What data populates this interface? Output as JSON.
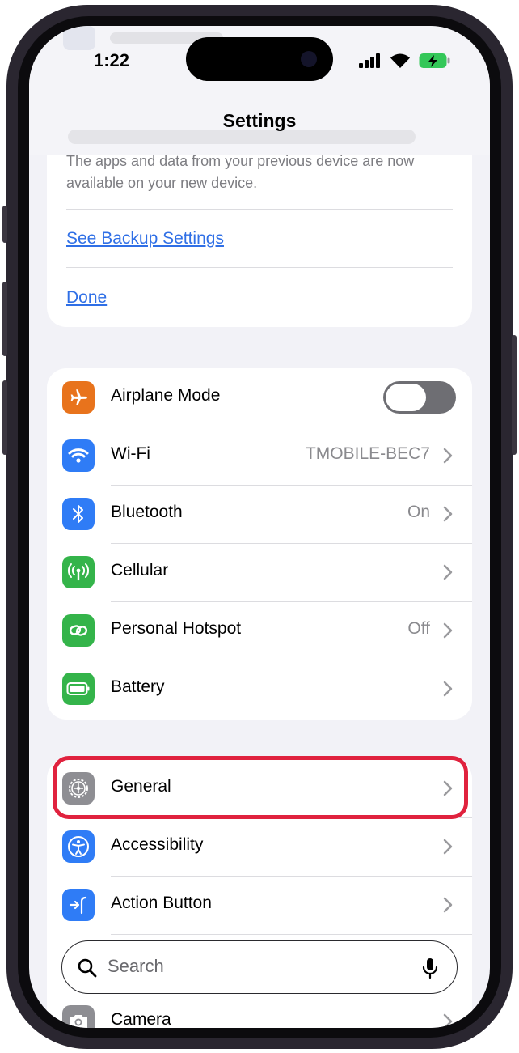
{
  "status_bar": {
    "time": "1:22"
  },
  "header": {
    "title": "Settings"
  },
  "backup_card": {
    "text": "The apps and data from your previous device are now available on your new device.",
    "see_backup_label": "See Backup Settings",
    "done_label": "Done"
  },
  "connectivity": [
    {
      "label": "Airplane Mode",
      "icon": "airplane-icon",
      "color": "#e8731c",
      "toggle_on": false
    },
    {
      "label": "Wi-Fi",
      "value": "TMOBILE-BEC7",
      "icon": "wifi-icon",
      "color": "#2f7cf6"
    },
    {
      "label": "Bluetooth",
      "value": "On",
      "icon": "bluetooth-icon",
      "color": "#2f7cf6"
    },
    {
      "label": "Cellular",
      "icon": "antenna-icon",
      "color": "#34b44a"
    },
    {
      "label": "Personal Hotspot",
      "value": "Off",
      "icon": "link-icon",
      "color": "#34b44a"
    },
    {
      "label": "Battery",
      "icon": "battery-icon",
      "color": "#34b44a"
    }
  ],
  "general_group": [
    {
      "label": "General",
      "icon": "gear-icon",
      "color": "#8e8e93",
      "highlighted": true
    },
    {
      "label": "Accessibility",
      "icon": "accessibility-icon",
      "color": "#2f7cf6"
    },
    {
      "label": "Action Button",
      "icon": "action-button-icon",
      "color": "#2f7cf6"
    },
    {
      "label": "Camera",
      "icon": "camera-icon",
      "color": "#8e8e93"
    }
  ],
  "search": {
    "placeholder": "Search",
    "icon": "search-icon",
    "mic_icon": "microphone-icon"
  },
  "highlight_color": "#e0223e"
}
